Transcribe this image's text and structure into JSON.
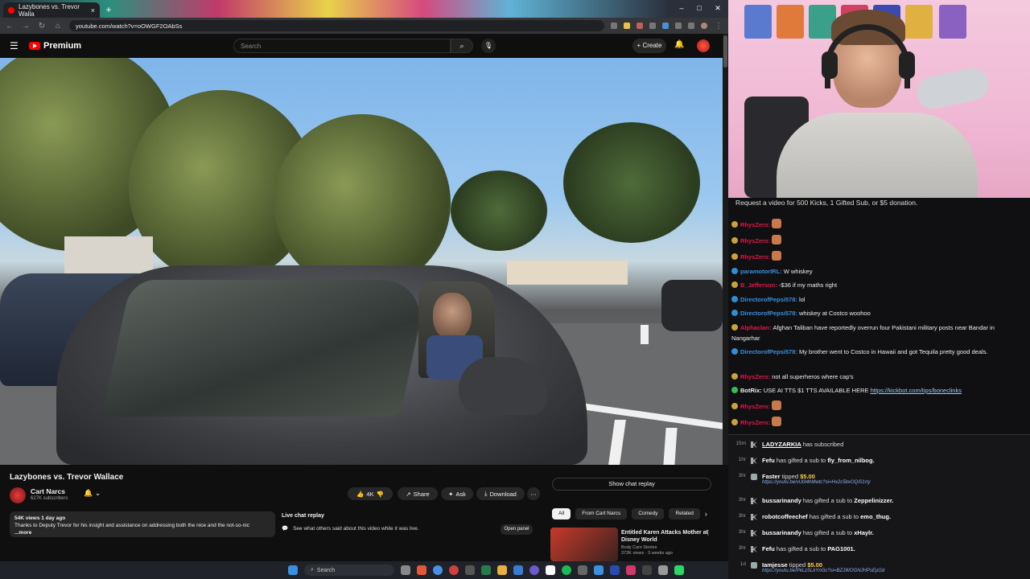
{
  "browser": {
    "tab_title": "Lazybones vs. Trevor Walla",
    "url": "youtube.com/watch?v=oOWGF2OAbSs",
    "new_tab_glyph": "+",
    "close_glyph": "×",
    "window_controls": [
      "–",
      "□",
      "✕"
    ]
  },
  "youtube": {
    "logo_text": "Premium",
    "search_placeholder": "Search",
    "create_label": "+ Create"
  },
  "video": {
    "title": "Lazybones vs. Trevor Wallace",
    "channel": "Cart Narcs",
    "subscribers": "627K subscribers",
    "likes": "4K",
    "share_label": "Share",
    "ask_label": "Ask",
    "download_label": "Download",
    "more_label": "⋯",
    "show_chat_label": "Show chat replay",
    "views_line": "54K views  1 day ago",
    "description": "Thanks to Deputy Trevor for his insight and assistance on addressing both the nice and the not-so-nic",
    "more_link": "...more",
    "live_replay_title": "Live chat replay",
    "live_replay_text": "See what others said about this video while it was live.",
    "open_panel_label": "Open panel"
  },
  "recommendations": {
    "chips": [
      "All",
      "From Cart Narcs",
      "Comedy",
      "Related"
    ],
    "item": {
      "title": "Entitled Karen Attacks Mother at Disney World",
      "channel": "Body Cam Stories",
      "meta": "372K views · 3 weeks ago"
    }
  },
  "taskbar": {
    "search_label": "Search"
  },
  "stream_chat": {
    "banner": "Request a video for 500 Kicks, 1 Gifted Sub, or $5 donation.",
    "messages": [
      {
        "user": "RhysZero:",
        "text": "",
        "color": "red",
        "emote": true
      },
      {
        "user": "RhysZero:",
        "text": "",
        "color": "red",
        "emote": true
      },
      {
        "user": "RhysZero:",
        "text": "",
        "color": "red",
        "emote": true
      },
      {
        "user": "paramotorIRL:",
        "text": "W whiskey",
        "color": "blu"
      },
      {
        "user": "B_Jefferson:",
        "text": "-$36 if my maths right",
        "color": "red"
      },
      {
        "user": "DirectorofPepsi578:",
        "text": "lol",
        "color": "blu"
      },
      {
        "user": "DirectorofPepsi578:",
        "text": "whiskey at Costco woohoo",
        "color": "blu"
      },
      {
        "user": "Alphaclan:",
        "text": "Afghan Taliban have reportedly overrun four Pakistani military posts near Bandar in Nangarhar",
        "color": "red"
      },
      {
        "user": "DirectorofPepsi578:",
        "text": "My brother went to Costco in Hawaii and got Tequila pretty good deals.",
        "color": "blu"
      },
      {
        "user": "RhysZero:",
        "text": "not all superheros where cap's",
        "color": "red"
      },
      {
        "user": "BotRix:",
        "text": "USE AI TTS $1 TTS AVAILABLE HERE",
        "link": "https://kickbot.com/tips/boneclinks",
        "color": "green"
      },
      {
        "user": "RhysZero:",
        "text": "",
        "color": "red",
        "emote": true
      },
      {
        "user": "RhysZero:",
        "text": "",
        "color": "red",
        "emote": true
      }
    ]
  },
  "events": [
    {
      "time": "15m",
      "user": "LADYZARKIA",
      "action": "has subscribed"
    },
    {
      "time": "1hr",
      "user": "Fefu",
      "action": "has gifted a sub to",
      "target": "fly_from_nilbog."
    },
    {
      "time": "3hr",
      "user": "Faster",
      "action": "tipped",
      "amount": "$5.00",
      "sub": "https://youtu.be/vU0l4hMwtc?si=Hx2c5bxOQiS1rty"
    },
    {
      "time": "3hr",
      "user": "bussarinandy",
      "action": "has gifted a sub to",
      "target": "Zeppelinizzer."
    },
    {
      "time": "3hr",
      "user": "robotcoffeechef",
      "action": "has gifted a sub to",
      "target": "emo_thug."
    },
    {
      "time": "3hr",
      "user": "bussarinandy",
      "action": "has gifted a sub to",
      "target": "xHaylr."
    },
    {
      "time": "3hr",
      "user": "Fefu",
      "action": "has gifted a sub to",
      "target": "PAG1001."
    },
    {
      "time": "1d",
      "user": "Iamjesse",
      "action": "tipped",
      "amount": "$5.00",
      "sub": "https://youtu.be/PkLzSLkYnGc?si=BZJWOGNJHPsEpGd"
    }
  ],
  "colors": {
    "yt_red": "#ff0000",
    "chat_red": "#e0184c",
    "chat_blue": "#3a8fe0",
    "tip_gold": "#ffd24a"
  }
}
